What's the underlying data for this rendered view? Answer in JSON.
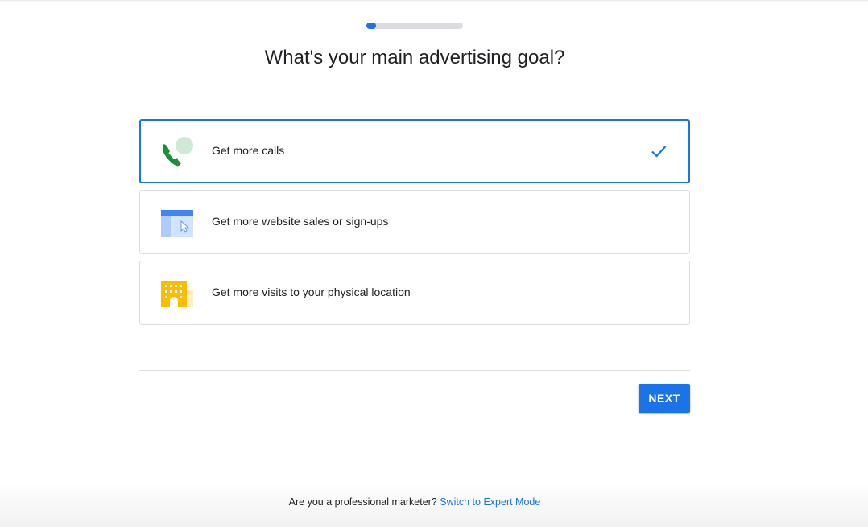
{
  "progress": {
    "value": 0.1,
    "color": "#1a73e8"
  },
  "page_title": "What's your main advertising goal?",
  "goals": [
    {
      "label": "Get more calls",
      "icon": "phone-chat-icon",
      "selected": true
    },
    {
      "label": "Get more website sales or sign-ups",
      "icon": "website-cursor-icon",
      "selected": false
    },
    {
      "label": "Get more visits to your physical location",
      "icon": "building-icon",
      "selected": false
    }
  ],
  "selected_icon": "check-icon",
  "next_label": "NEXT",
  "footer": {
    "question": "Are you a professional marketer?",
    "link_text": "Switch to Expert Mode"
  },
  "colors": {
    "accent": "#1a73e8",
    "phone_green": "#1e8e3e",
    "bubble_green": "#ceead6",
    "website_blue": "#4285f4",
    "website_light": "#d2e3fc",
    "building_yellow": "#fbbc04",
    "building_light": "#feefc3"
  }
}
